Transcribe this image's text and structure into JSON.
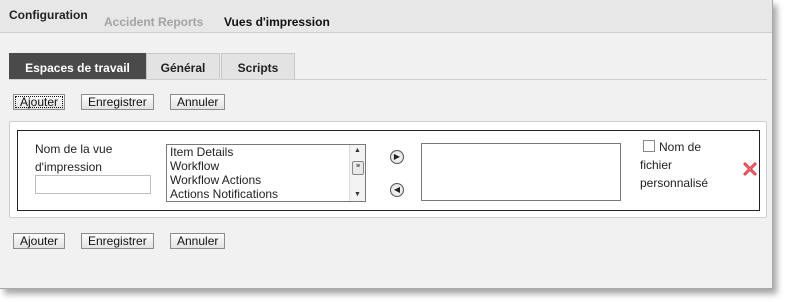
{
  "top_tabs": {
    "configuration": "Configuration",
    "accident_reports": "Accident Reports",
    "print_views": "Vues d'impression"
  },
  "sub_tabs": {
    "workspaces": "Espaces de travail",
    "general": "Général",
    "scripts": "Scripts"
  },
  "actions": {
    "add": "Ajouter",
    "save": "Enregistrer",
    "cancel": "Annuler"
  },
  "print_view": {
    "name_label": "Nom de la vue d'impression",
    "name_value": "",
    "available_items": [
      "Item Details",
      "Workflow",
      "Workflow Actions",
      "Actions Notifications"
    ],
    "selected_items": [],
    "custom_filename_label": "Nom de fichier personnalisé",
    "custom_filename_checked": false
  },
  "icons": {
    "move_right": "arrow-right-circle-icon",
    "move_left": "arrow-left-circle-icon",
    "delete": "red-x-delete-icon"
  },
  "colors": {
    "active_tab_bg": "#4a4a4a",
    "inactive_top_tab": "#a3a3a3",
    "delete_red": "#d9343a"
  }
}
